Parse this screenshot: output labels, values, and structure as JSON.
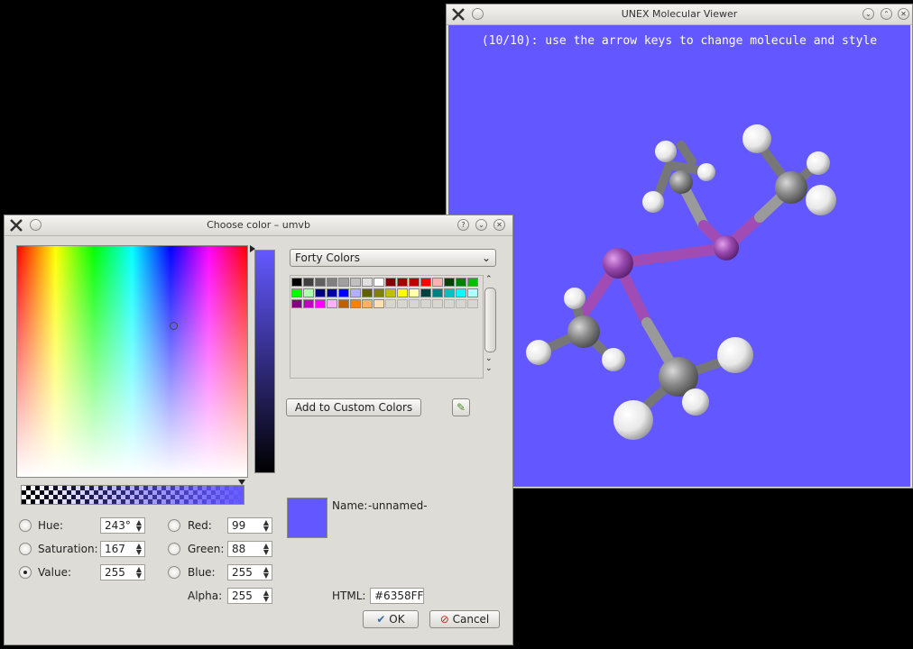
{
  "viewer": {
    "title": "UNEX Molecular Viewer",
    "overlay_text": "(10/10): use the arrow keys to change molecule and style",
    "background_color": "#6358FF"
  },
  "dialog": {
    "title": "Choose color – umvb",
    "palette_select": "Forty Colors",
    "palette": [
      "#000000",
      "#404040",
      "#606060",
      "#808080",
      "#a0a0a0",
      "#c0c0c0",
      "#e0e0e0",
      "#ffffff",
      "#800000",
      "#a00000",
      "#c00000",
      "#ff0000",
      "#ffb0b0",
      "#004000",
      "#008000",
      "#00c000",
      "#00ff00",
      "#b0ffb0",
      "#000080",
      "#0000a0",
      "#0000ff",
      "#b0b0ff",
      "#606000",
      "#808000",
      "#c0c000",
      "#ffff00",
      "#ffffb0",
      "#004040",
      "#008080",
      "#00c0c0",
      "#00ffff",
      "#b0ffff",
      "#800080",
      "#c000c0",
      "#ff00ff",
      "#ffb0ff",
      "#c06000",
      "#ff8000",
      "#ffb060",
      "#ffe0b0"
    ],
    "add_custom_label": "Add to Custom Colors",
    "name_label": "Name:",
    "name_value": "-unnamed-",
    "html_label": "HTML:",
    "html_value": "#6358FF",
    "current_color": "#6358FF",
    "fields": {
      "hue": {
        "label": "Hue:",
        "value": "243°"
      },
      "saturation": {
        "label": "Saturation:",
        "value": "167"
      },
      "value": {
        "label": "Value:",
        "value": "255",
        "checked": true
      },
      "red": {
        "label": "Red:",
        "value": "99"
      },
      "green": {
        "label": "Green:",
        "value": "88"
      },
      "blue": {
        "label": "Blue:",
        "value": "255"
      },
      "alpha": {
        "label": "Alpha:",
        "value": "255"
      }
    },
    "ok_label": "OK",
    "cancel_label": "Cancel"
  }
}
